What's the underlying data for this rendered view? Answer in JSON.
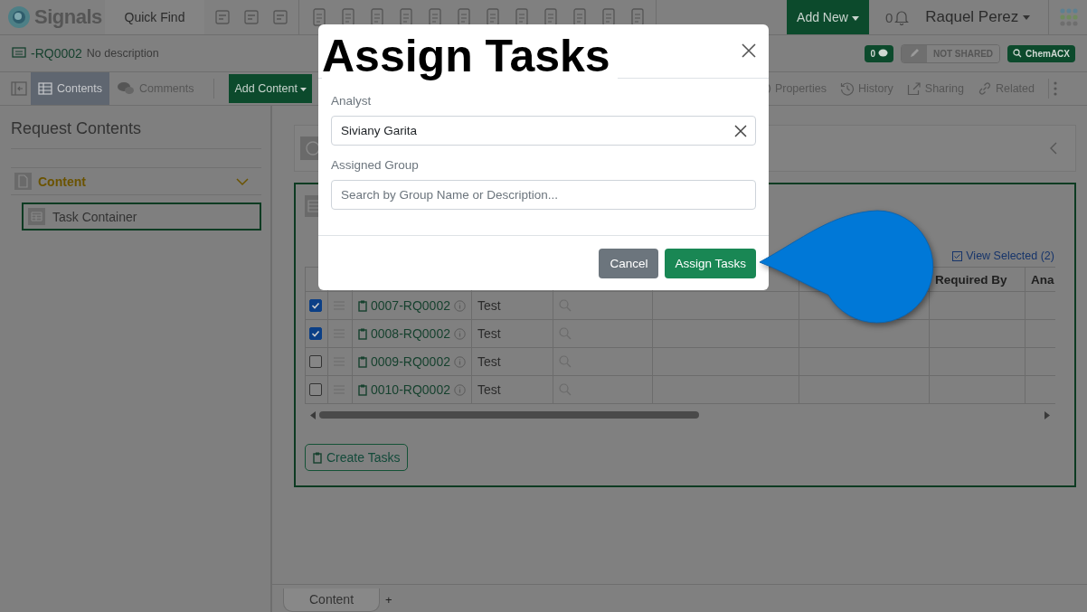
{
  "header": {
    "logo": "Signals",
    "quick_find": "Quick Find",
    "add_new": "Add New",
    "notification_count": "0",
    "user": "Raquel Perez"
  },
  "record": {
    "id": "-RQ0002",
    "description": "No description",
    "comment_count": "0",
    "sharing": "NOT SHARED",
    "search_button": "ChemACX"
  },
  "toolbar": {
    "tabs": [
      {
        "label": "Contents",
        "selected": true
      },
      {
        "label": "Comments",
        "selected": false
      }
    ],
    "add_content": "Add Content",
    "actions": [
      {
        "label": "Properties",
        "kind": "properties"
      },
      {
        "label": "History",
        "kind": "history"
      },
      {
        "label": "Sharing",
        "kind": "sharing"
      },
      {
        "label": "Related",
        "kind": "related"
      }
    ]
  },
  "sidebar": {
    "title": "Request Contents",
    "section": {
      "label": "Content",
      "expanded": true,
      "items": [
        {
          "label": "Task Container",
          "selected": true
        }
      ]
    }
  },
  "table": {
    "view_selected": "View Selected (2)",
    "columns": [
      {
        "label": "Required By"
      },
      {
        "label": "Ana"
      }
    ],
    "rows": [
      {
        "checked": true,
        "id": "0007-RQ0002",
        "name": "Test"
      },
      {
        "checked": true,
        "id": "0008-RQ0002",
        "name": "Test"
      },
      {
        "checked": false,
        "id": "0009-RQ0002",
        "name": "Test"
      },
      {
        "checked": false,
        "id": "0010-RQ0002",
        "name": "Test"
      }
    ]
  },
  "create_button": "Create Tasks",
  "bottom_tabs": [
    {
      "label": "Content",
      "selected": true
    }
  ],
  "add_tab": "+",
  "modal": {
    "title": "Assign Tasks",
    "analyst_label": "Analyst",
    "analyst_value": "Siviany Garita",
    "group_label": "Assigned Group",
    "group_placeholder": "Search by Group Name or Description...",
    "cancel": "Cancel",
    "confirm": "Assign Tasks"
  }
}
